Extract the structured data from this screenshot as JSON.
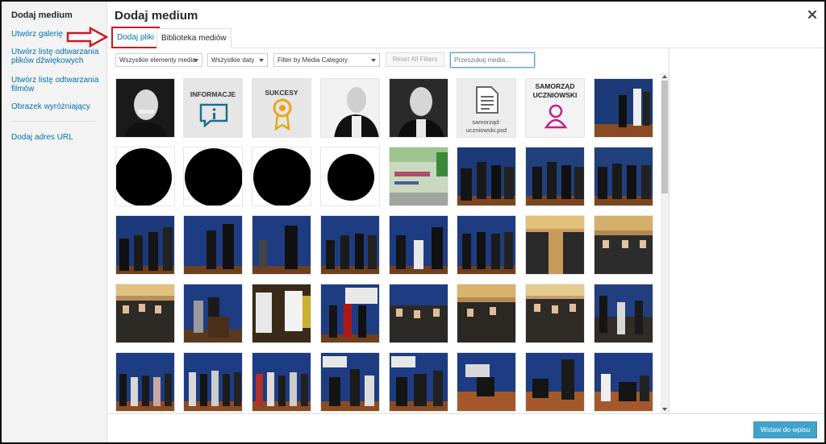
{
  "sidebar": {
    "heading": "Dodaj medium",
    "items": [
      {
        "label": "Utwórz galerię"
      },
      {
        "label": "Utwórz listę odtwarzania plików dźwiękowych"
      },
      {
        "label": "Utwórz listę odtwarzania filmów"
      },
      {
        "label": "Obrazek wyróżniający"
      },
      {
        "label": "Dodaj adres URL"
      }
    ]
  },
  "header": {
    "title": "Dodaj medium",
    "close_icon": "close-icon"
  },
  "tabs": [
    {
      "label": "Dodaj pliki"
    },
    {
      "label": "Biblioteka mediów"
    }
  ],
  "toolbar": {
    "type_filter": "Wszystkie elementy media",
    "date_filter": "Wszystkie daty",
    "category_filter": "Filter by Media Category",
    "reset_label": "Reset All Filters",
    "search_placeholder": "Przeszukaj media..."
  },
  "tiles": {
    "informacje": "INFORMACJE",
    "sukcesy": "SUKCESY",
    "samorzad_top": "SAMORZĄD",
    "samorzad_bottom": "UCZNIOWSKI",
    "psd_caption": "samorząd-uczniowski.psd"
  },
  "footer": {
    "insert_label": "Wstaw do wpisu"
  },
  "colors": {
    "accent": "#0073aa",
    "highlight": "#d01820",
    "primary_button": "#0085ba"
  }
}
